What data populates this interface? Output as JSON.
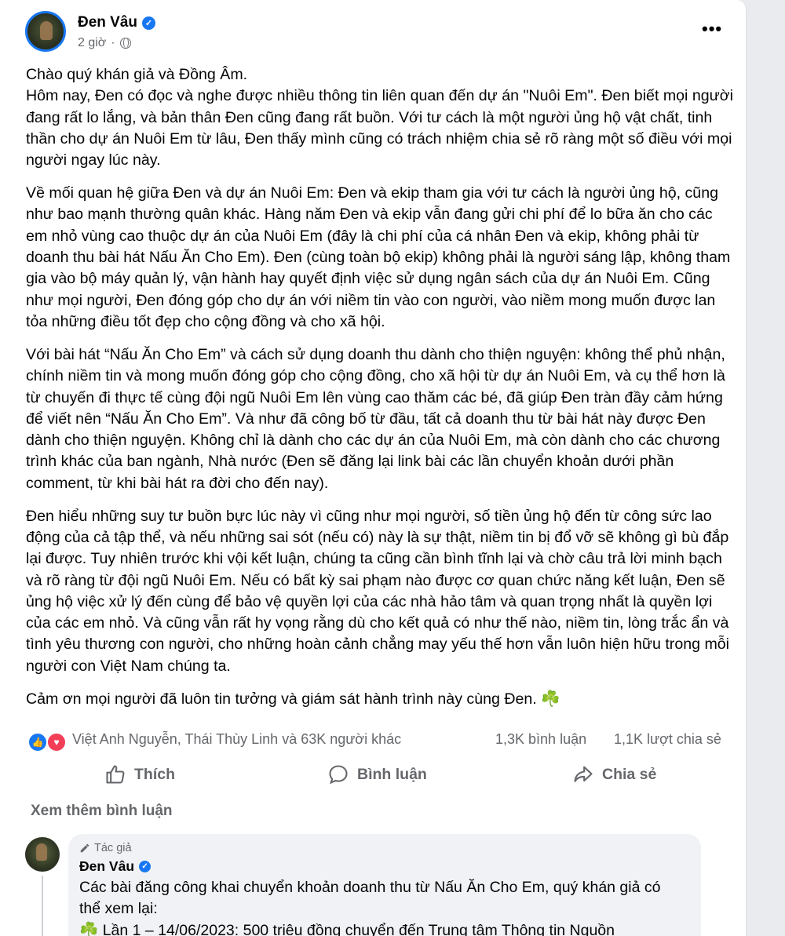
{
  "post": {
    "author": "Đen Vâu",
    "time": "2 giờ",
    "more_label": "•••",
    "paragraphs": [
      "Chào quý khán giả và Đồng Âm.\nHôm nay, Đen có đọc và nghe được nhiều thông tin liên quan đến dự án \"Nuôi Em\". Đen biết mọi người đang rất lo lắng, và bản thân Đen cũng đang rất buồn. Với tư cách là một người ủng hộ vật chất, tinh thần cho dự án Nuôi Em từ lâu, Đen thấy mình cũng có trách nhiệm chia sẻ rõ ràng một số điều với mọi người ngay lúc này.",
      "Về mối quan hệ giữa Đen và dự án Nuôi Em: Đen và ekip tham gia với tư cách là người ủng hộ, cũng như bao mạnh thường quân khác. Hàng năm Đen và ekip vẫn đang gửi chi phí để lo bữa ăn cho các em nhỏ vùng cao thuộc dự án của Nuôi Em (đây là chi phí của cá nhân Đen và ekip, không phải từ doanh thu bài hát Nấu Ăn Cho Em). Đen (cùng toàn bộ ekip) không phải là người sáng lập, không tham gia vào bộ máy quản lý, vận hành hay quyết định việc sử dụng ngân sách của dự án Nuôi Em. Cũng như mọi người, Đen đóng góp cho dự án với niềm tin vào con người, vào niềm mong muốn được lan tỏa những điều tốt đẹp cho cộng đồng và cho xã hội.",
      "Với bài hát “Nấu Ăn Cho Em” và cách sử dụng doanh thu dành cho thiện nguyện: không thể phủ nhận, chính niềm tin và mong muốn đóng góp cho cộng đồng, cho xã hội từ dự án Nuôi Em, và cụ thể hơn là từ chuyến đi thực tế cùng đội ngũ Nuôi Em lên vùng cao thăm các bé, đã giúp Đen tràn đầy cảm hứng để viết nên “Nấu Ăn Cho Em”. Và như đã công bố từ đầu, tất cả doanh thu từ bài hát này được Đen dành cho thiện nguyện. Không chỉ là dành cho các dự án của Nuôi Em, mà còn dành cho các chương trình khác của ban ngành, Nhà nước (Đen sẽ đăng lại link bài các lần chuyển khoản dưới phần comment, từ khi bài hát ra đời cho đến nay).",
      "Đen hiểu những suy tư buồn bực lúc này vì cũng như mọi người, số tiền ủng hộ đến từ công sức lao động của cả tập thể, và nếu những sai sót (nếu có) này là sự thật, niềm tin bị đổ vỡ sẽ không gì bù đắp lại được. Tuy nhiên trước khi vội kết luận, chúng ta cũng cần bình tĩnh lại và chờ câu trả lời minh bạch và rõ ràng từ đội ngũ Nuôi Em. Nếu có bất kỳ sai phạm nào được cơ quan chức năng kết luận, Đen sẽ ủng hộ việc xử lý đến cùng để bảo vệ quyền lợi của các nhà hảo tâm và quan trọng nhất là quyền lợi của các em nhỏ. Và cũng vẫn rất hy vọng rằng dù cho kết quả có như thế nào, niềm tin, lòng trắc ẩn và tình yêu thương con người, cho những hoàn cảnh chẳng may yếu thế hơn vẫn luôn hiện hữu trong mỗi người con Việt Nam chúng ta.",
      "Cảm ơn mọi người đã luôn tin tưởng và giám sát hành trình này cùng Đen. ☘️"
    ],
    "reactions_text": "Việt Anh Nguyễn, Thái Thùy Linh và 63K người khác",
    "comments_count": "1,3K bình luận",
    "shares_count": "1,1K lượt chia sẻ"
  },
  "actions": {
    "like": "Thích",
    "comment": "Bình luận",
    "share": "Chia sẻ"
  },
  "comments": {
    "more_label": "Xem thêm bình luận",
    "items": [
      {
        "badge": "Tác giả",
        "author": "Đen Vâu",
        "text": "Các bài đăng công khai chuyển khoản doanh thu từ Nấu Ăn Cho Em, quý khán giả có thể xem lại:\n☘️ Lần 1 – 14/06/2023: 500 triệu đồng chuyển đến Trung tâm Thông tin Nguồn"
      }
    ]
  },
  "colors": {
    "accent": "#1877f2",
    "love": "#f33e58",
    "secondary_text": "#65676b",
    "bubble": "#f0f2f5"
  },
  "icons": [
    "globe-icon",
    "verified-icon",
    "like-reaction-icon",
    "love-reaction-icon",
    "thumbs-up-icon",
    "comment-icon",
    "share-icon",
    "pencil-icon"
  ]
}
